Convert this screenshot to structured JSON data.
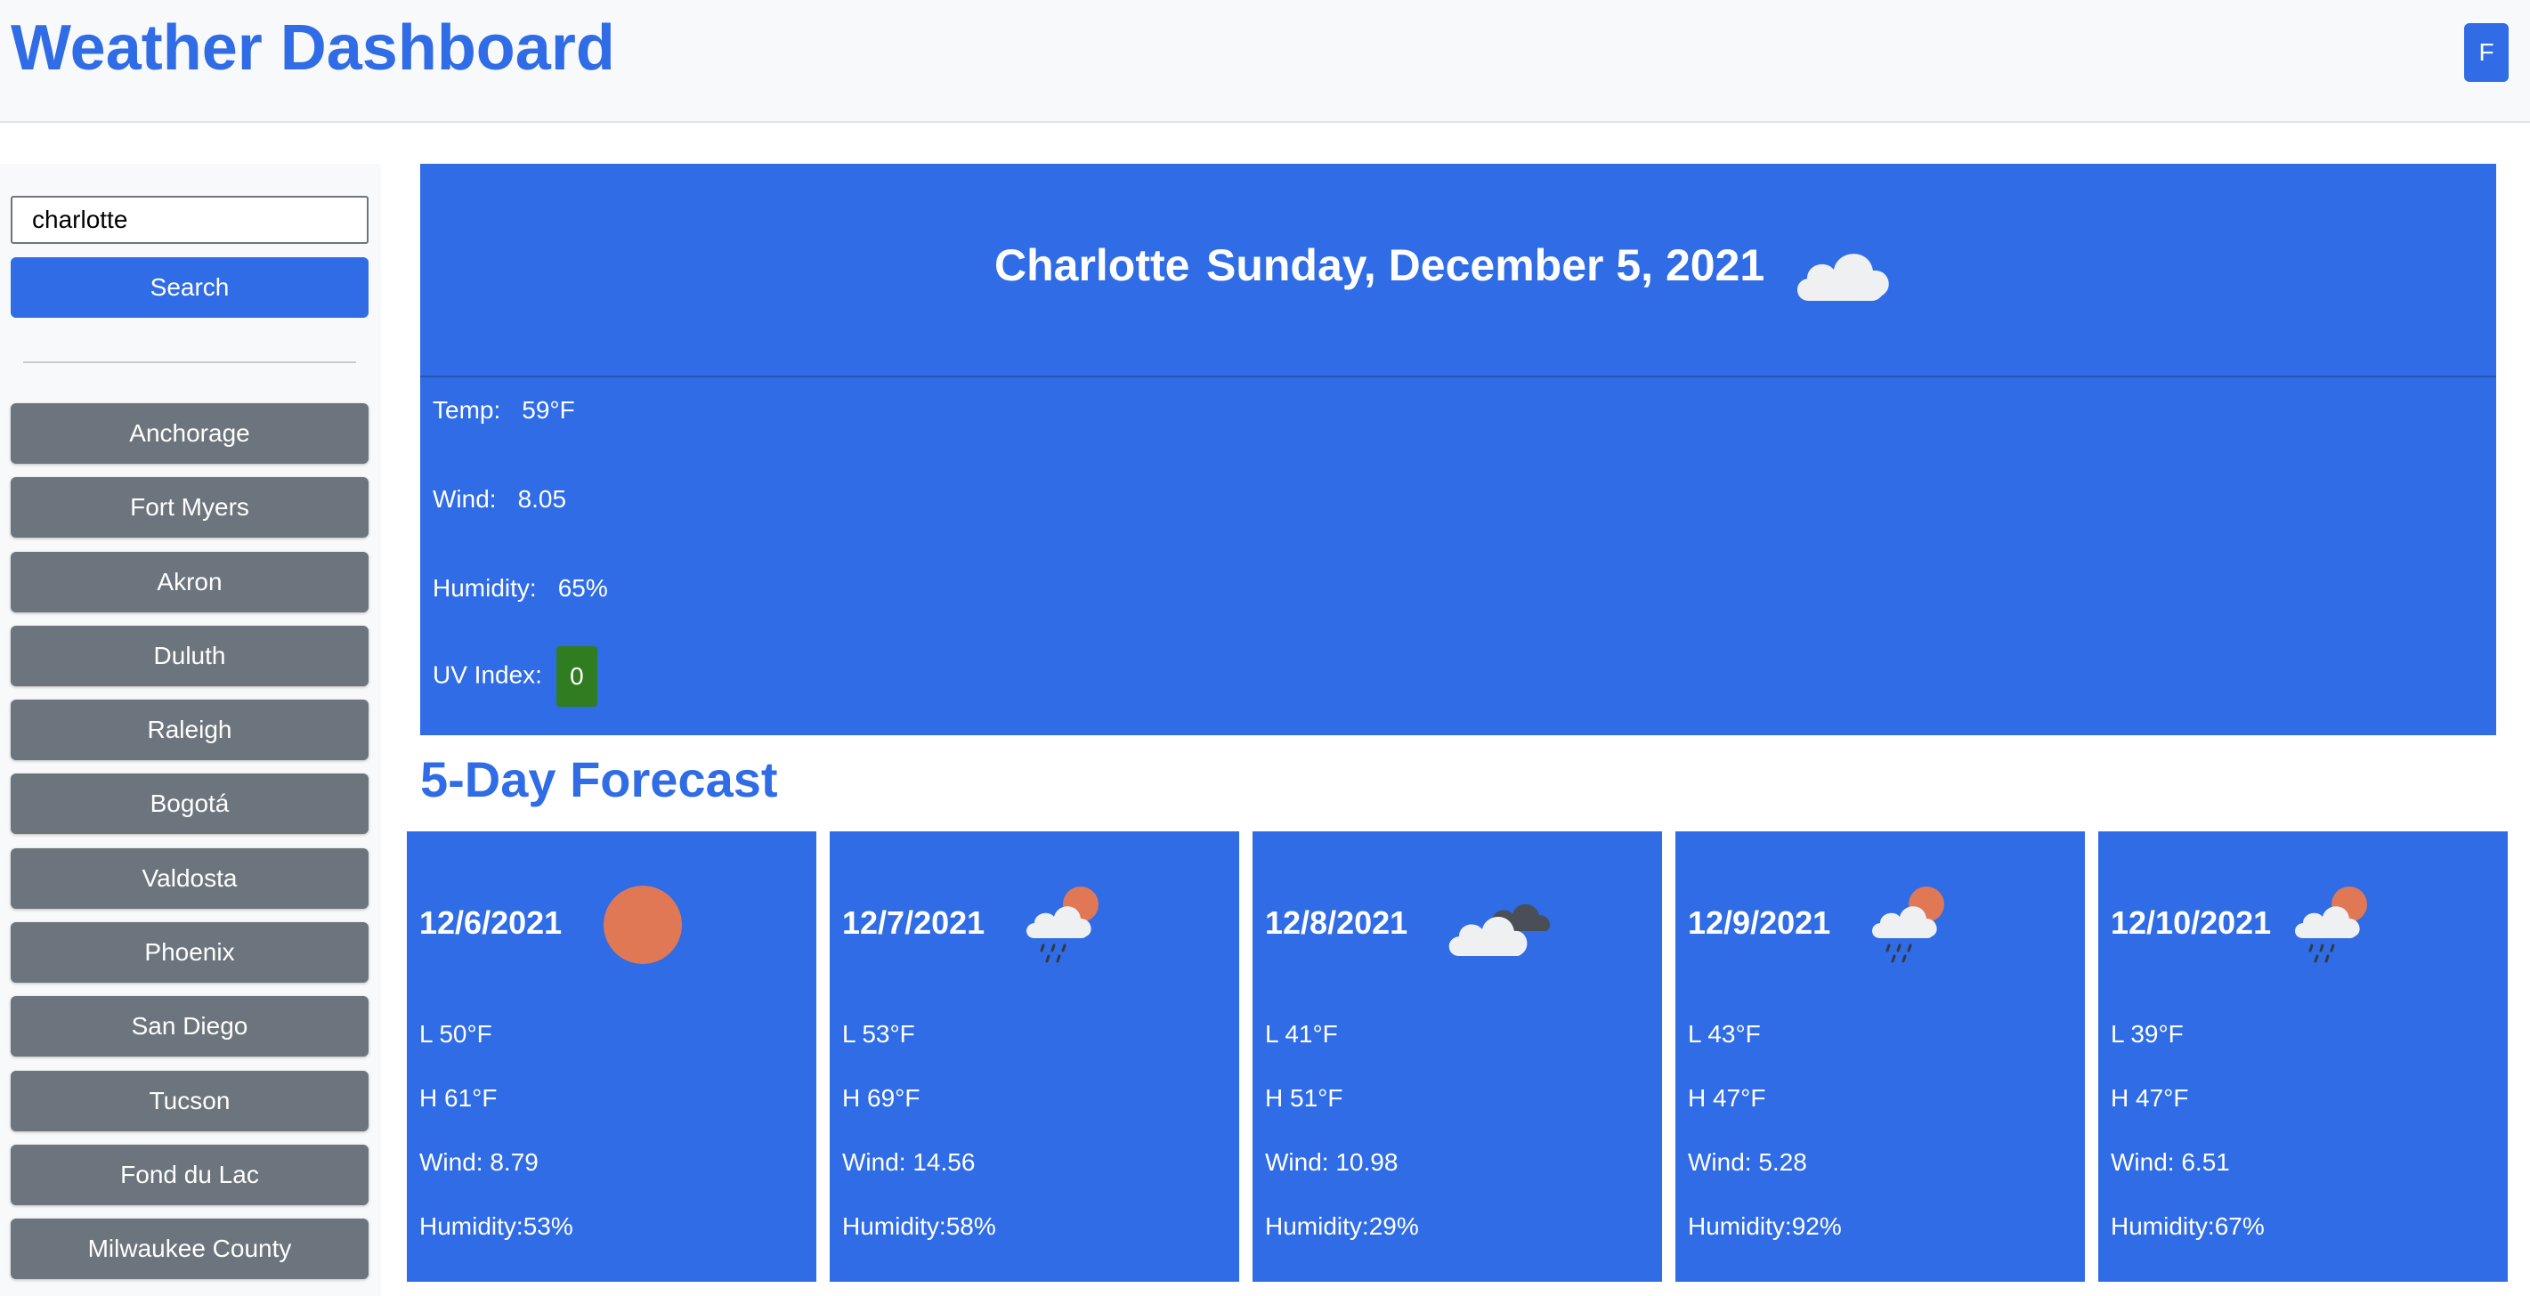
{
  "header": {
    "title": "Weather Dashboard",
    "toggle_label": "F"
  },
  "sidebar": {
    "search_value": "charlotte",
    "search_label": "Search",
    "cities": [
      "Anchorage",
      "Fort Myers",
      "Akron",
      "Duluth",
      "Raleigh",
      "Bogotá",
      "Valdosta",
      "Phoenix",
      "San Diego",
      "Tucson",
      "Fond du Lac",
      "Milwaukee County"
    ]
  },
  "current": {
    "city": "Charlotte",
    "date": "Sunday, December 5, 2021",
    "icon": "cloud-icon",
    "temp_label": "Temp:",
    "temp_value": "59°F",
    "wind_label": "Wind:",
    "wind_value": "8.05",
    "humidity_label": "Humidity:",
    "humidity_value": "65%",
    "uv_label": "UV Index:",
    "uv_value": "0",
    "uv_color": "#2f7d20"
  },
  "forecast": {
    "title": "5-Day Forecast",
    "days": [
      {
        "date": "12/6/2021",
        "icon": "sun-icon",
        "low": "L 50°F",
        "high": "H 61°F",
        "wind": "Wind: 8.79",
        "humidity": "Humidity:53%"
      },
      {
        "date": "12/7/2021",
        "icon": "rain-sun-icon",
        "low": "L 53°F",
        "high": "H 69°F",
        "wind": "Wind: 14.56",
        "humidity": "Humidity:58%"
      },
      {
        "date": "12/8/2021",
        "icon": "clouds-icon",
        "low": "L 41°F",
        "high": "H 51°F",
        "wind": "Wind: 10.98",
        "humidity": "Humidity:29%"
      },
      {
        "date": "12/9/2021",
        "icon": "rain-sun-icon",
        "low": "L 43°F",
        "high": "H 47°F",
        "wind": "Wind: 5.28",
        "humidity": "Humidity:92%"
      },
      {
        "date": "12/10/2021",
        "icon": "rain-sun-icon",
        "low": "L 39°F",
        "high": "H 47°F",
        "wind": "Wind: 6.51",
        "humidity": "Humidity:67%"
      }
    ]
  },
  "colors": {
    "primary": "#2f6ce5",
    "secondary": "#6c757d",
    "sun": "#e07856"
  }
}
